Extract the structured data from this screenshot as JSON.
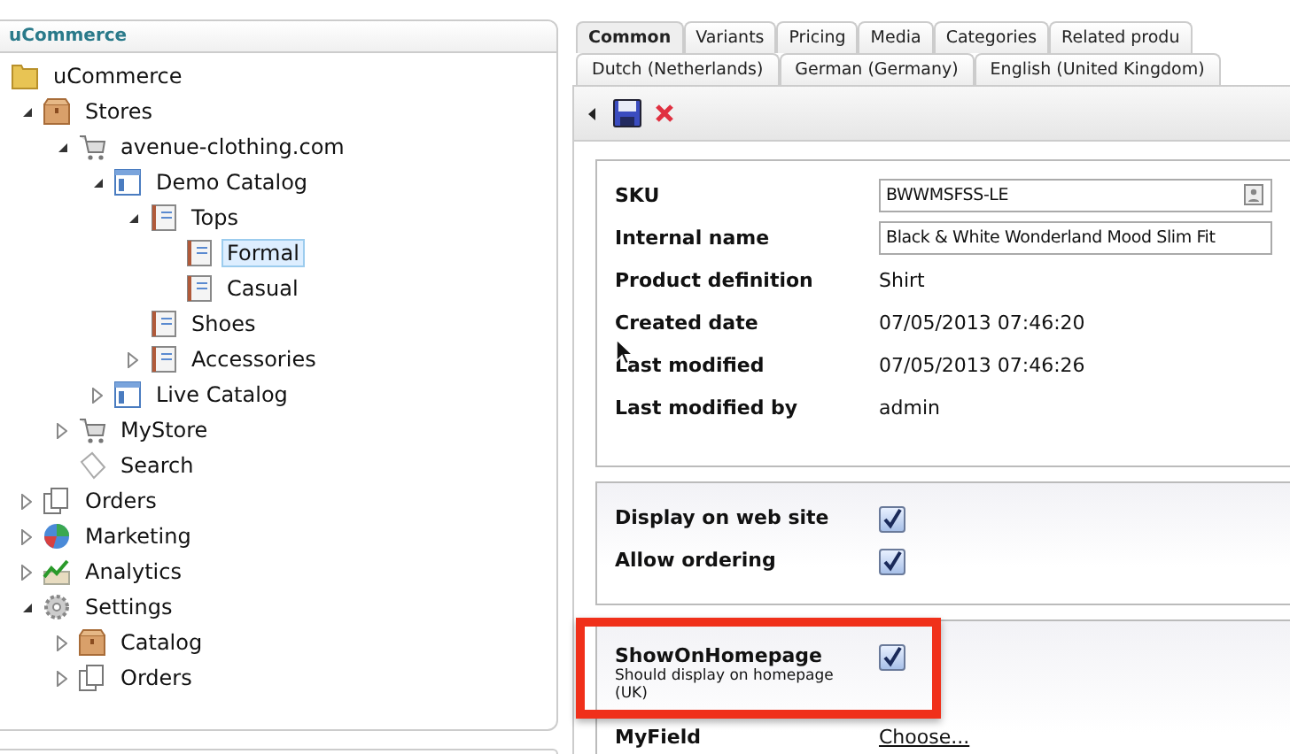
{
  "tree_panel": {
    "title": "uCommerce",
    "items": [
      {
        "label": "uCommerce",
        "kind": "folder",
        "selected": false,
        "children": [
          {
            "label": "Stores",
            "kind": "box",
            "expanded": true,
            "selected": false,
            "children": [
              {
                "label": "avenue-clothing.com",
                "kind": "cart",
                "expanded": true,
                "selected": false,
                "children": [
                  {
                    "label": "Demo Catalog",
                    "kind": "catalog",
                    "expanded": true,
                    "selected": false,
                    "children": [
                      {
                        "label": "Tops",
                        "kind": "category",
                        "expanded": true,
                        "selected": false,
                        "children": [
                          {
                            "label": "Formal",
                            "kind": "category",
                            "selected": true
                          },
                          {
                            "label": "Casual",
                            "kind": "category",
                            "selected": false
                          }
                        ]
                      },
                      {
                        "label": "Shoes",
                        "kind": "category",
                        "selected": false
                      },
                      {
                        "label": "Accessories",
                        "kind": "category",
                        "expanded": false,
                        "selected": false
                      }
                    ]
                  },
                  {
                    "label": "Live Catalog",
                    "kind": "catalog",
                    "expanded": false,
                    "selected": false
                  }
                ]
              },
              {
                "label": "MyStore",
                "kind": "cart",
                "expanded": false,
                "selected": false
              },
              {
                "label": "Search",
                "kind": "search",
                "selected": false
              }
            ]
          },
          {
            "label": "Orders",
            "kind": "orders",
            "expanded": false,
            "selected": false
          },
          {
            "label": "Marketing",
            "kind": "marketing",
            "expanded": false,
            "selected": false
          },
          {
            "label": "Analytics",
            "kind": "analytics",
            "expanded": false,
            "selected": false
          },
          {
            "label": "Settings",
            "kind": "settings",
            "expanded": true,
            "selected": false,
            "children": [
              {
                "label": "Catalog",
                "kind": "box",
                "expanded": false,
                "selected": false
              },
              {
                "label": "Orders",
                "kind": "orders",
                "expanded": false,
                "selected": false
              }
            ]
          }
        ]
      }
    ]
  },
  "tabs": [
    {
      "label": "Common",
      "selected": true
    },
    {
      "label": "Variants",
      "selected": false
    },
    {
      "label": "Pricing",
      "selected": false
    },
    {
      "label": "Media",
      "selected": false
    },
    {
      "label": "Categories",
      "selected": false
    },
    {
      "label": "Related produ",
      "selected": false
    }
  ],
  "language_tabs": [
    {
      "label": "Dutch (Netherlands)",
      "selected": false
    },
    {
      "label": "German (Germany)",
      "selected": false
    },
    {
      "label": "English (United Kingdom)",
      "selected": false
    }
  ],
  "sections": [
    {
      "fields": [
        {
          "label": "SKU",
          "kind": "input",
          "value": "BWWMSFSS-LE"
        },
        {
          "label": "Internal name",
          "kind": "input",
          "value": "Black & White Wonderland Mood Slim Fit"
        },
        {
          "label": "Product definition",
          "kind": "text",
          "value": "Shirt"
        },
        {
          "label": "Created date",
          "kind": "text",
          "value": "07/05/2013 07:46:20"
        },
        {
          "label": "Last modified",
          "kind": "text",
          "value": "07/05/2013 07:46:26"
        },
        {
          "label": "Last modified by",
          "kind": "text",
          "value": "admin"
        }
      ]
    },
    {
      "fields": [
        {
          "label": "Display on web site",
          "kind": "checkbox",
          "checked": true
        },
        {
          "label": "Allow ordering",
          "kind": "checkbox",
          "checked": true
        }
      ]
    },
    {
      "fields": [
        {
          "label": "ShowOnHomepage",
          "kind": "checkbox",
          "checked": true,
          "description": "Should display on homepage (UK)",
          "highlighted": true
        },
        {
          "label": "MyField",
          "kind": "link",
          "value": "Choose..."
        }
      ]
    }
  ]
}
